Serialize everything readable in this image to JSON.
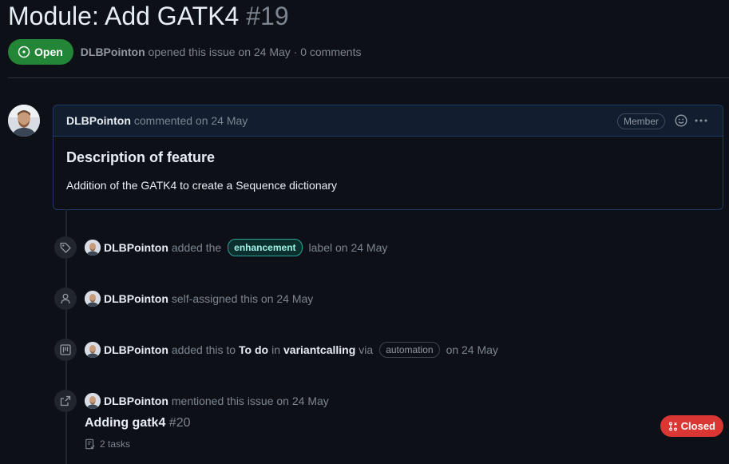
{
  "issue": {
    "title": "Module: Add GATK4",
    "number": "#19",
    "state": "Open",
    "author": "DLBPointon",
    "meta_text": "opened this issue on 24 May · 0 comments"
  },
  "comment": {
    "author": "DLBPointon",
    "action": "commented on 24 May",
    "role_badge": "Member",
    "heading": "Description of feature",
    "body": "Addition of the GATK4 to create a Sequence dictionary"
  },
  "events": [
    {
      "icon": "tag-icon",
      "user": "DLBPointon",
      "text_before": "added the",
      "label": "enhancement",
      "text_after": "label on 24 May"
    },
    {
      "icon": "person-icon",
      "user": "DLBPointon",
      "text": "self-assigned this on 24 May"
    },
    {
      "icon": "project-icon",
      "user": "DLBPointon",
      "text_before": "added this to",
      "column": "To do",
      "in_text": "in",
      "project": "variantcalling",
      "via_text": "via",
      "automation": "automation",
      "text_after": "on 24 May"
    },
    {
      "icon": "cross-reference-icon",
      "user": "DLBPointon",
      "text": "mentioned this issue on 24 May"
    }
  ],
  "reference": {
    "title": "Adding gatk4",
    "number": "#20",
    "state": "Closed",
    "tasks": "2 tasks"
  },
  "colors": {
    "background": "#0d1117",
    "open_green": "#238636",
    "closed_red": "#da3633",
    "label_teal": "#2aa39b"
  }
}
